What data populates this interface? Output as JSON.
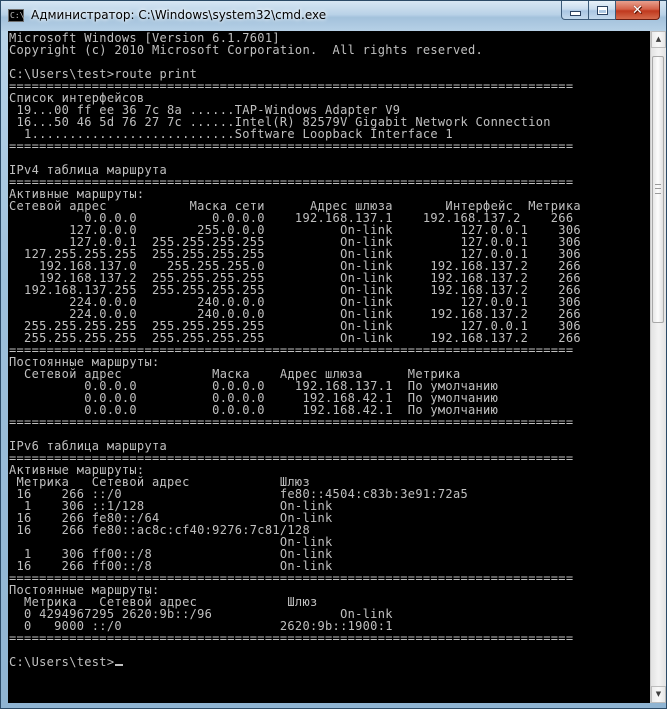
{
  "window": {
    "title": "Администратор: C:\\Windows\\system32\\cmd.exe",
    "app_icon": "cmd-console-icon",
    "icon_glyph": "C:\\",
    "buttons": {
      "minimize": "minimize-icon",
      "maximize": "maximize-icon",
      "close": "close-icon",
      "close_glyph": "✕"
    }
  },
  "console": {
    "colors": {
      "background": "#000000",
      "text": "#c0c0c0"
    },
    "header": [
      "Microsoft Windows [Version 6.1.7601]",
      "Copyright (c) 2010 Microsoft Corporation.  All rights reserved."
    ],
    "prompt": "C:\\Users\\test>",
    "command": "route print",
    "separator": "===========================================================================",
    "interfaces": {
      "title": "Список интерфейсов",
      "lines": [
        " 19...00 ff ee 36 7c 8a ......TAP-Windows Adapter V9",
        " 16...50 46 5d 76 27 7c ......Intel(R) 82579V Gigabit Network Connection",
        "  1...........................Software Loopback Interface 1"
      ]
    },
    "ipv4": {
      "title": "IPv4 таблица маршрута",
      "active_title": "Активные маршруты:",
      "active_header": "Сетевой адрес           Маска сети      Адрес шлюза       Интерфейс  Метрика",
      "active_rows": [
        "          0.0.0.0          0.0.0.0    192.168.137.1    192.168.137.2    266",
        "        127.0.0.0        255.0.0.0          On-link         127.0.0.1    306",
        "        127.0.0.1  255.255.255.255          On-link         127.0.0.1    306",
        "  127.255.255.255  255.255.255.255          On-link         127.0.0.1    306",
        "    192.168.137.0    255.255.255.0          On-link     192.168.137.2    266",
        "    192.168.137.2  255.255.255.255          On-link     192.168.137.2    266",
        "  192.168.137.255  255.255.255.255          On-link     192.168.137.2    266",
        "        224.0.0.0        240.0.0.0          On-link         127.0.0.1    306",
        "        224.0.0.0        240.0.0.0          On-link     192.168.137.2    266",
        "  255.255.255.255  255.255.255.255          On-link         127.0.0.1    306",
        "  255.255.255.255  255.255.255.255          On-link     192.168.137.2    266"
      ],
      "persistent_title": "Постоянные маршруты:",
      "persistent_header": "  Сетевой адрес            Маска    Адрес шлюза      Метрика",
      "persistent_rows": [
        "          0.0.0.0          0.0.0.0    192.168.137.1  По умолчанию",
        "          0.0.0.0          0.0.0.0     192.168.42.1  По умолчанию",
        "          0.0.0.0          0.0.0.0     192.168.42.1  По умолчанию"
      ]
    },
    "ipv6": {
      "title": "IPv6 таблица маршрута",
      "active_title": "Активные маршруты:",
      "active_header": " Метрика   Сетевой адрес            Шлюз",
      "active_rows": [
        " 16    266 ::/0                     fe80::4504:c83b:3e91:72a5",
        "  1    306 ::1/128                  On-link",
        " 16    266 fe80::/64                On-link",
        " 16    266 fe80::ac8c:cf40:9276:7c81/128",
        "                                    On-link",
        "  1    306 ff00::/8                 On-link",
        " 16    266 ff00::/8                 On-link"
      ],
      "persistent_title": "Постоянные маршруты:",
      "persistent_header": "  Метрика   Сетевой адрес            Шлюз",
      "persistent_rows": [
        "  0 4294967295 2620:9b::/96                 On-link",
        "  0   9000 ::/0                     2620:9b::1900:1"
      ]
    }
  }
}
